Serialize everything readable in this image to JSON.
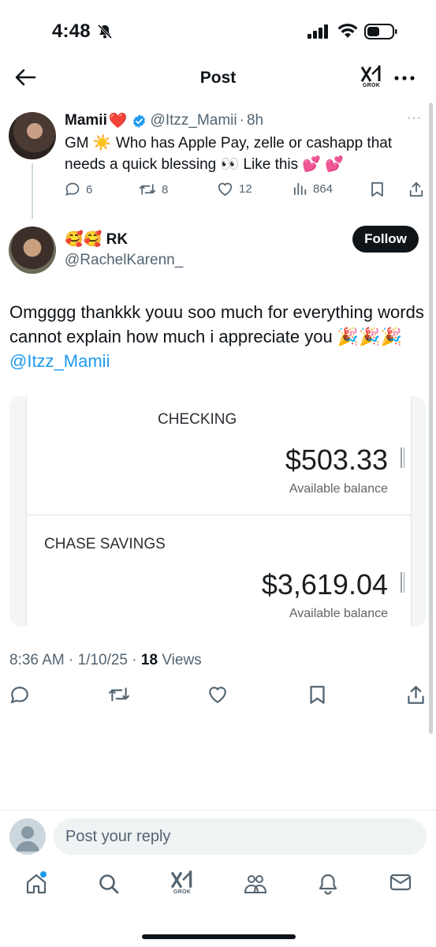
{
  "status_bar": {
    "time": "4:48"
  },
  "header": {
    "title": "Post",
    "grok_label": "GROK"
  },
  "parent_post": {
    "name": "Mamii",
    "name_emoji": "❤️",
    "handle": "@Itzz_Mamii",
    "sep": "·",
    "age": "8h",
    "text": "GM ☀️  Who has Apple Pay, zelle or cashapp that needs a quick blessing 👀 Like this 💕 💕",
    "stats": {
      "replies": "6",
      "reposts": "8",
      "likes": "12",
      "views": "864"
    }
  },
  "reply_post": {
    "name": "🥰🥰 RK",
    "handle": "@RachelKarenn_",
    "follow_label": "Follow",
    "text": "Omgggg thankkk youu soo much for everything words cannot explain how much i appreciate you 🎉🎉🎉",
    "mention": "@Itzz_Mamii",
    "image": {
      "account1_label": "CHECKING",
      "account1_amount": "$503.33",
      "account1_sub": "Available balance",
      "account2_label": "CHASE SAVINGS",
      "account2_amount": "$3,619.04",
      "account2_sub": "Available balance"
    },
    "meta": {
      "time": "8:36 AM",
      "date": "1/10/25",
      "views_count": "18",
      "views_label": "Views"
    }
  },
  "reply_bar": {
    "placeholder": "Post your reply"
  },
  "tab_bar": {
    "grok_label": "GROK"
  },
  "colors": {
    "accent": "#1d9bf0",
    "text": "#0f1419",
    "muted": "#536471",
    "heart": "#f91880"
  }
}
